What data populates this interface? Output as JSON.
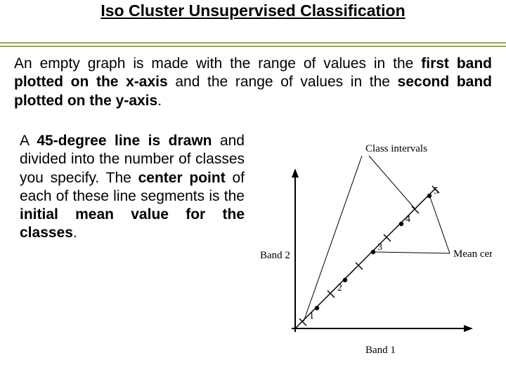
{
  "title": "Iso Cluster Unsupervised Classification",
  "para1_parts": {
    "t1": "An empty graph is made with the range of values in the ",
    "b1": "first band plotted on the x-axis",
    "t2": " and the range of values in the ",
    "b2": "second band plotted on the y-axis",
    "t3": "."
  },
  "para2_parts": {
    "t1": "A ",
    "b1": "45-degree line is drawn",
    "t2": " and divided into the number of classes you specify. The ",
    "b2": "center point",
    "t3": " of each of these line segments is the ",
    "b3": "initial mean value for the classes",
    "t4": "."
  },
  "diagram": {
    "label_class_intervals": "Class intervals",
    "label_mean_centers": "Mean centers",
    "label_band1": "Band 1",
    "label_band2": "Band 2",
    "n1": "1",
    "n2": "2",
    "n3": "3",
    "n4": "4",
    "n5": "5"
  }
}
